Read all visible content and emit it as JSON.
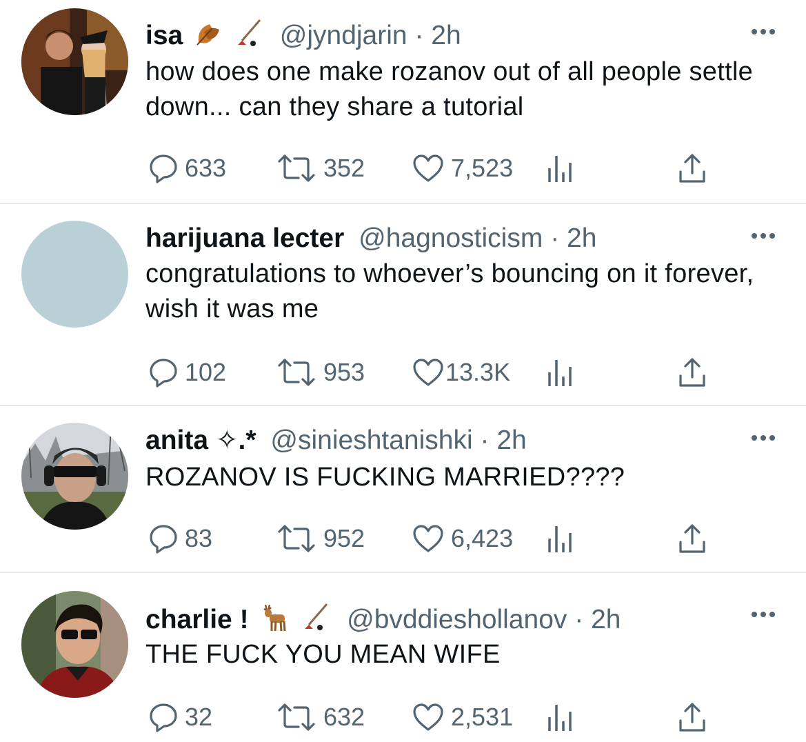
{
  "colors": {
    "text": "#0f1419",
    "muted": "#536471",
    "divider": "#e6e9eb",
    "avatar_placeholder": "#b8d0d6"
  },
  "tweets": [
    {
      "name": "isa",
      "emoji": [
        "leaf-icon",
        "hockey-stick-icon"
      ],
      "handle": "@jyndjarin",
      "separator": "·",
      "time": "2h",
      "text": "how does one make rozanov out of all people settle down... can they share a tutorial",
      "replies": "633",
      "retweets": "352",
      "likes": "7,523"
    },
    {
      "name": "harijuana lecter",
      "emoji": [],
      "handle": "@hagnosticism",
      "separator": "·",
      "time": "2h",
      "text": "congratulations to whoever’s bouncing on it forever, wish it was me",
      "replies": "102",
      "retweets": "953",
      "likes": "13.3K"
    },
    {
      "name": "anita ✧.*",
      "emoji": [],
      "handle": "@sinieshtanishki",
      "separator": "·",
      "time": "2h",
      "text": "ROZANOV IS FUCKING MARRIED????",
      "replies": "83",
      "retweets": "952",
      "likes": "6,423"
    },
    {
      "name": "charlie !",
      "emoji": [
        "deer-icon",
        "hockey-stick-icon"
      ],
      "handle": "@bvddieshollanov",
      "separator": "·",
      "time": "2h",
      "text": "THE FUCK YOU MEAN WIFE",
      "replies": "32",
      "retweets": "632",
      "likes": "2,531"
    }
  ]
}
